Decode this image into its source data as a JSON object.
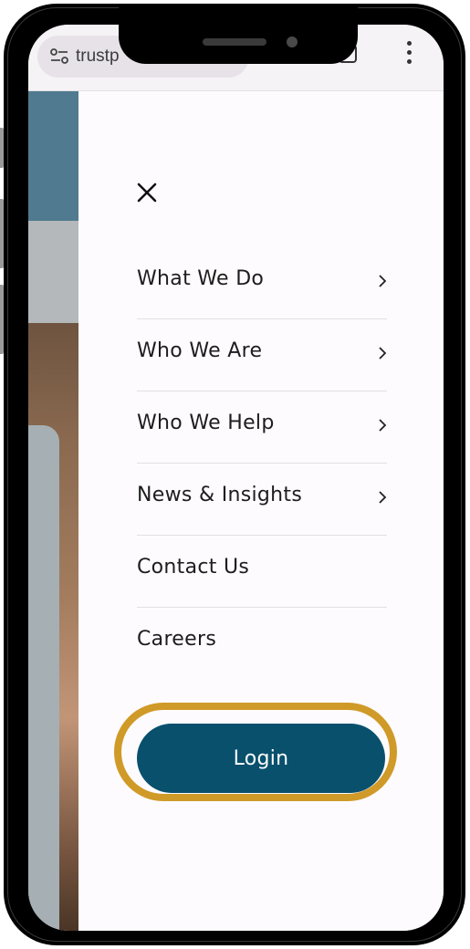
{
  "browser": {
    "url_text": "trustp",
    "tabs_icon": "tab-count-icon",
    "menu_icon": "more-vert-icon",
    "site_icon": "tune-icon"
  },
  "drawer": {
    "close_icon": "close-icon",
    "nav_items": [
      {
        "label": "What We Do",
        "has_submenu": true
      },
      {
        "label": "Who We Are",
        "has_submenu": true
      },
      {
        "label": "Who We Help",
        "has_submenu": true
      },
      {
        "label": "News & Insights",
        "has_submenu": true
      },
      {
        "label": "Contact Us",
        "has_submenu": false
      },
      {
        "label": "Careers",
        "has_submenu": false
      }
    ],
    "login_label": "Login"
  },
  "colors": {
    "login_button": "#09506d",
    "highlight_ring": "#d09a28",
    "hero_band": "#4f7a8f",
    "drawer_bg": "#fdfbfd"
  }
}
